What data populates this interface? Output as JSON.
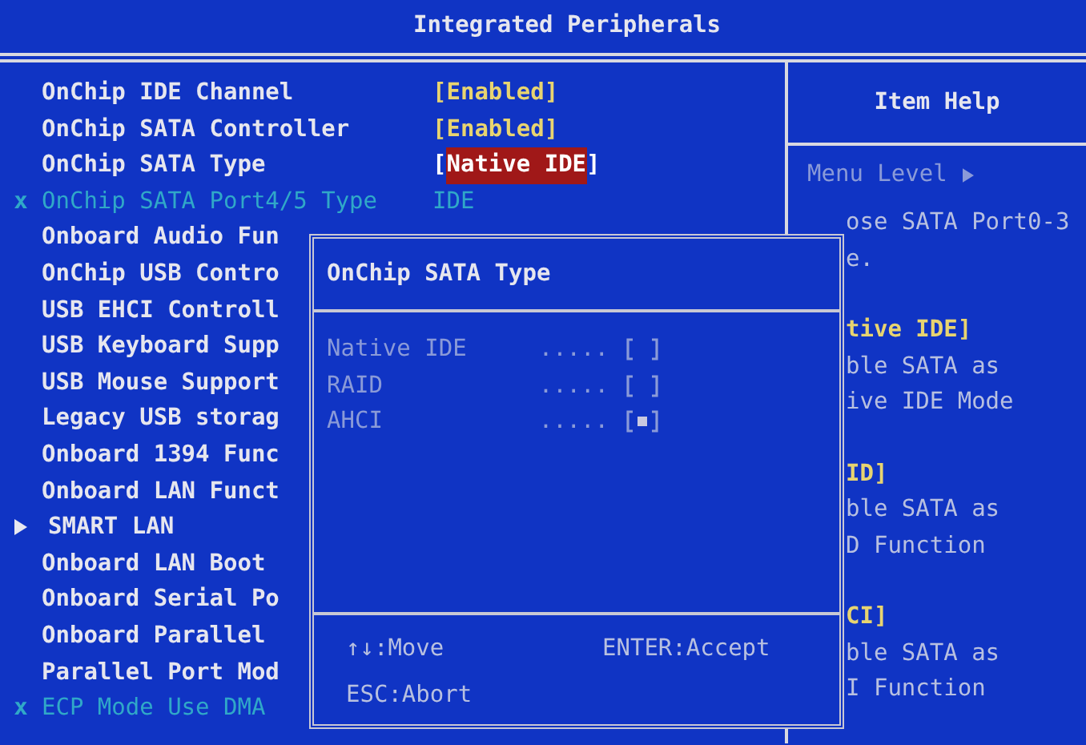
{
  "window": {
    "title": "Integrated Peripherals"
  },
  "settings": [
    {
      "kind": "setting",
      "label": "OnChip IDE Channel",
      "value": "[Enabled]",
      "selected": false
    },
    {
      "kind": "setting",
      "label": "OnChip SATA Controller",
      "value": "[Enabled]",
      "selected": false
    },
    {
      "kind": "setting",
      "label": "OnChip SATA Type",
      "value": "[Native IDE]",
      "selected": true
    },
    {
      "kind": "disabled",
      "marker": "x",
      "label": "OnChip SATA Port4/5 Type",
      "value": "IDE",
      "selected": false
    },
    {
      "kind": "setting",
      "label": "Onboard Audio Fun",
      "selected": false
    },
    {
      "kind": "setting",
      "label": "OnChip USB Contro",
      "selected": false
    },
    {
      "kind": "setting",
      "label": "USB EHCI Controll",
      "selected": false
    },
    {
      "kind": "setting",
      "label": "USB Keyboard Supp",
      "selected": false
    },
    {
      "kind": "setting",
      "label": "USB Mouse Support",
      "selected": false
    },
    {
      "kind": "setting",
      "label": "Legacy USB storag",
      "selected": false
    },
    {
      "kind": "setting",
      "label": "Onboard 1394 Func",
      "selected": false
    },
    {
      "kind": "setting",
      "label": "Onboard LAN Funct",
      "selected": false
    },
    {
      "kind": "submenu",
      "label": "SMART LAN",
      "selected": false
    },
    {
      "kind": "setting",
      "label": "Onboard LAN Boot",
      "selected": false
    },
    {
      "kind": "setting",
      "label": "Onboard Serial Po",
      "selected": false
    },
    {
      "kind": "setting",
      "label": "Onboard Parallel",
      "selected": false
    },
    {
      "kind": "setting",
      "label": "Parallel Port Mod",
      "selected": false
    },
    {
      "kind": "disabled",
      "marker": "x",
      "label": "ECP Mode Use DMA",
      "selected": false
    }
  ],
  "help": {
    "title": "Item Help",
    "menu_level": "Menu Level",
    "lines": [
      {
        "kind": "text",
        "text": "ose SATA Port0-3"
      },
      {
        "kind": "text",
        "text": "e."
      },
      {
        "kind": "heading",
        "text": "tive IDE]"
      },
      {
        "kind": "text",
        "text": "ble SATA as"
      },
      {
        "kind": "text",
        "text": "ive IDE Mode"
      },
      {
        "kind": "heading",
        "text": "ID]"
      },
      {
        "kind": "text",
        "text": "ble SATA as"
      },
      {
        "kind": "text",
        "text": "D Function"
      },
      {
        "kind": "heading",
        "text": "CI]"
      },
      {
        "kind": "text",
        "text": "ble SATA as"
      },
      {
        "kind": "text",
        "text": "I Function"
      }
    ]
  },
  "popup": {
    "title": "OnChip SATA Type",
    "options": [
      {
        "label": "Native IDE",
        "dots": ".....",
        "checked": false
      },
      {
        "label": "RAID",
        "dots": ".....",
        "checked": false
      },
      {
        "label": "AHCI",
        "dots": ".....",
        "checked": true
      }
    ],
    "footer": {
      "move": "↑↓:Move",
      "accept": "ENTER:Accept",
      "abort": "ESC:Abort"
    }
  }
}
